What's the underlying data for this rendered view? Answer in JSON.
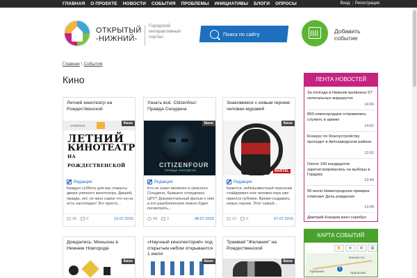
{
  "topnav": [
    "ГЛАВНАЯ",
    "О ПРОЕКТЕ",
    "НОВОСТИ",
    "СОБЫТИЯ",
    "ПРОБЛЕМЫ",
    "ИНИЦИАТИВЫ",
    "БЛОГИ",
    "ОПРОСЫ"
  ],
  "auth": {
    "login": "Вход",
    "sep": "|",
    "register": "Регистрация"
  },
  "logo": {
    "line1": "ОТКРЫТЫЙ",
    "line2": "-НИЖНИЙ-",
    "sub1": "Городской",
    "sub2": "интерактивный",
    "sub3": "портал"
  },
  "search": {
    "label": "Поиск по сайту"
  },
  "add_event": {
    "line1": "Добавить",
    "line2": "событие"
  },
  "breadcrumb": {
    "home": "Главная",
    "sep": "\\",
    "section": "События"
  },
  "page_title": "Кино",
  "cards": [
    {
      "title": "Летний кинотеатр на Рождественской",
      "badge": "Кино",
      "editor": "Редакция",
      "excerpt": "Каждую субботу для вас открыты двери уличного кинотеатра. Дверей, правда, нет, но кино самое что ни на есть настоящее! Это просто...",
      "views": "30",
      "comments": "0",
      "date": "10.07.2015",
      "img": {
        "a": "ЛЕТНИЙ",
        "b": "КИНОТЕАТР",
        "c": "НА РОЖДЕСТВЕНСКОЙ",
        "top": "СТОРОНА"
      }
    },
    {
      "title": "Узнать всё. Citizenfour: Правда Сноудена",
      "badge": "Кино",
      "editor": "Редакция",
      "excerpt": "Кто не знает великого и ужасного Сноудена, бывшего сотрудника ЦРУ? Документальный фильм о нем и его разоблачениях можно будет посмотреть...",
      "views": "68",
      "comments": "0",
      "date": "08.07.2015",
      "img": {
        "a": "CITIZENFOUR",
        "b": "ПРАВДА СНОУДЕНА"
      }
    },
    {
      "title": "Знакомимся с новым героем: человек-муравей",
      "badge": "Кино",
      "editor": "Редакция",
      "excerpt": "Кажется, небезызвестный персонаж спайдермен или человек-паук уже приелся публике. Время создавать новых героев. Этот самый...",
      "views": "12",
      "comments": "0",
      "date": "07.07.2015",
      "img": {
        "a": "MARVEL"
      }
    },
    {
      "title": "Дождались: Миньоны в Нижнем Новгороде",
      "badge": "Кино"
    },
    {
      "title": "«Научный кинолекторий» под открытым небом открывается 1 июля",
      "badge": "Кино"
    },
    {
      "title": "Трамвай \"Желание\" на Рождественской",
      "badge": "Кино"
    }
  ],
  "news": {
    "heading": "ЛЕНТА НОВОСТЕЙ",
    "items": [
      {
        "text": "За полгода в Нижнем выявлено 57 нелегальных маршруток",
        "time": "14:06"
      },
      {
        "text": "860 нижегородцев отправились служить в армию",
        "time": "14:01"
      },
      {
        "text": "Конкурс по благоустройству проходит в Автозаводском районе",
        "time": "13:52"
      },
      {
        "text": "Около 100 кандидатов зарегистрировались на выборы в Гордуму",
        "time": "13:49"
      },
      {
        "text": "95 июля Нижегородская ярмарка отмечает День рождения",
        "time": "13:05"
      },
      {
        "text": "Дмитрий Кокарев взял серебро",
        "time": ""
      }
    ]
  },
  "map": {
    "heading": "КАРТА СОБЫТИЙ",
    "pin": "5",
    "labels": [
      "Ильино-Ск",
      "Кремлево",
      "Приокский"
    ]
  },
  "colors": {
    "topbar": "#2b2b2b",
    "search": "#1e6fbd",
    "news": "#c4237f",
    "map": "#4aa12e",
    "add": "#5db533"
  }
}
